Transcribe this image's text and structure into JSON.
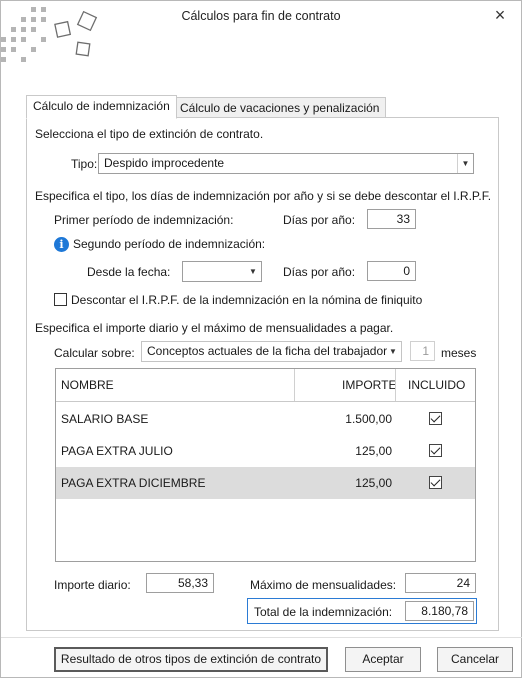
{
  "window": {
    "title": "Cálculos para fin de contrato",
    "close_glyph": "×"
  },
  "tabs": [
    {
      "label": "Cálculo de indemnización",
      "active": true
    },
    {
      "label": "Cálculo de vacaciones y penalización",
      "active": false
    }
  ],
  "extincion": {
    "section_label": "Selecciona el tipo de extinción de contrato.",
    "tipo_label": "Tipo:",
    "tipo_value": "Despido improcedente"
  },
  "indemnizacion": {
    "section_label": "Especifica el tipo, los días de indemnización por año y si se debe descontar el I.R.P.F.",
    "primer_periodo_label": "Primer período de indemnización:",
    "dias_por_anio_label": "Días por año:",
    "primer_dias_value": "33",
    "segundo_periodo_label": "Segundo período de indemnización:",
    "desde_fecha_label": "Desde la fecha:",
    "desde_fecha_value": "",
    "segundo_dias_label": "Días por año:",
    "segundo_dias_value": "0",
    "descontar_irpf_label": "Descontar el I.R.P.F. de la indemnización en la nómina de finiquito",
    "descontar_irpf_checked": false
  },
  "importe": {
    "section_label": "Especifica el importe diario y el máximo de mensualidades a pagar.",
    "calcular_sobre_label": "Calcular sobre:",
    "calcular_sobre_value": "Conceptos actuales de la ficha del trabajador",
    "meses_value": "1",
    "meses_label": "meses"
  },
  "grid": {
    "columns": [
      "NOMBRE",
      "IMPORTE",
      "INCLUIDO"
    ],
    "rows": [
      {
        "nombre": "SALARIO BASE",
        "importe": "1.500,00",
        "incluido": true,
        "selected": false
      },
      {
        "nombre": "PAGA EXTRA JULIO",
        "importe": "125,00",
        "incluido": true,
        "selected": false
      },
      {
        "nombre": "PAGA EXTRA DICIEMBRE",
        "importe": "125,00",
        "incluido": true,
        "selected": true
      }
    ]
  },
  "totales": {
    "importe_diario_label": "Importe diario:",
    "importe_diario_value": "58,33",
    "max_mensualidades_label": "Máximo de mensualidades:",
    "max_mensualidades_value": "24",
    "total_label": "Total de la indemnización:",
    "total_value": "8.180,78"
  },
  "buttons": {
    "otros_tipos": "Resultado de otros tipos de extinción de contrato",
    "aceptar": "Aceptar",
    "cancelar": "Cancelar"
  },
  "colors": {
    "accent": "#2b7bd4",
    "info_icon": "#1e78d7",
    "selected_row": "#dcdcdc"
  }
}
